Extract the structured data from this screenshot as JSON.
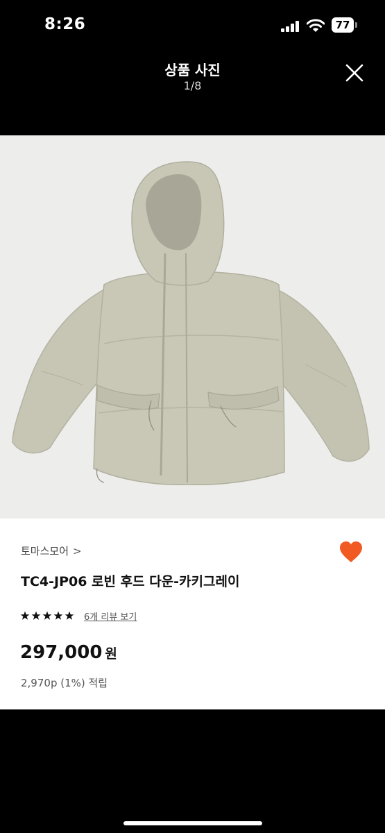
{
  "status_bar": {
    "time": "8:26",
    "battery": "77"
  },
  "viewer": {
    "title": "상품 사진",
    "counter": "1/8",
    "close_icon": "close-icon"
  },
  "photo": {
    "subject_icon": "puffer-jacket-image"
  },
  "product": {
    "brand": "토마스모어",
    "brand_chevron": ">",
    "name": "TC4-JP06 로빈 후드 다운-카키그레이",
    "rating": 5,
    "review_link": "6개 리뷰 보기",
    "price": "297,000",
    "price_unit": "원",
    "points": "2,970p (1%) 적립",
    "wishlisted": true,
    "heart_color": "#f15a22"
  },
  "colors": {
    "background": "#000000",
    "photo_bg": "#ededec",
    "jacket": "#c6c4b3",
    "accent": "#f15a22"
  }
}
